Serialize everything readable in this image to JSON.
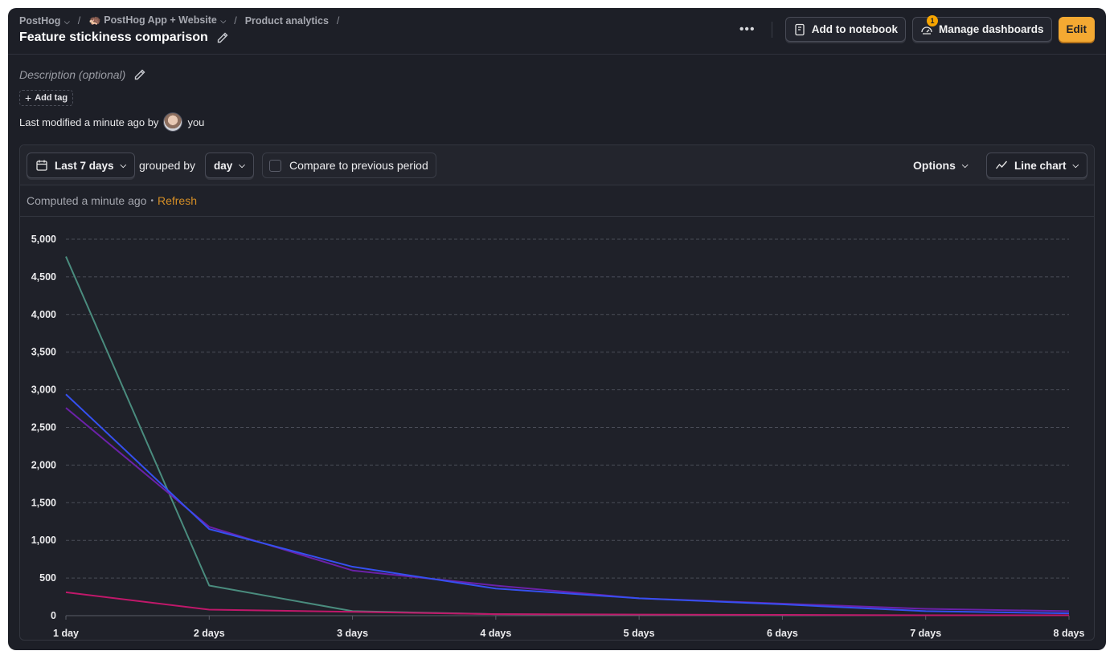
{
  "breadcrumbs": {
    "org": "PostHog",
    "project": "🦔 PostHog App + Website",
    "section": "Product analytics",
    "separator": "/"
  },
  "page": {
    "title": "Feature stickiness comparison",
    "description_placeholder": "Description (optional)",
    "add_tag_label": "Add tag",
    "modified_text": "Last modified a minute ago by",
    "modified_user": "you"
  },
  "toolbar": {
    "more_label": "•••",
    "add_to_notebook": "Add to notebook",
    "manage_dashboards": "Manage dashboards",
    "manage_dashboards_badge": "1",
    "edit": "Edit"
  },
  "controls": {
    "date_range": "Last 7 days",
    "grouped_by_label": "grouped by",
    "interval": "day",
    "compare_label": "Compare to previous period",
    "options_label": "Options",
    "chart_type_label": "Line chart"
  },
  "computed": {
    "text": "Computed a minute ago",
    "dot": "•",
    "refresh_label": "Refresh"
  },
  "chart_data": {
    "type": "line",
    "x": [
      "1 day",
      "2 days",
      "3 days",
      "4 days",
      "5 days",
      "6 days",
      "7 days",
      "8 days"
    ],
    "ylim": [
      0,
      5000
    ],
    "yticks": [
      0,
      500,
      1000,
      1500,
      2000,
      2500,
      3000,
      3500,
      4000,
      4500,
      5000
    ],
    "ytick_labels": [
      "0",
      "500",
      "1,000",
      "1,500",
      "2,000",
      "2,500",
      "3,000",
      "3,500",
      "4,000",
      "4,500",
      "5,000"
    ],
    "grid": true,
    "legend": "none",
    "series": [
      {
        "color": "#4a8c7e",
        "values": [
          4770,
          400,
          60,
          20,
          10,
          5,
          5,
          5
        ]
      },
      {
        "color": "#6b21a8",
        "values": [
          2760,
          1180,
          600,
          400,
          230,
          160,
          90,
          60
        ]
      },
      {
        "color": "#3550f0",
        "values": [
          2940,
          1150,
          650,
          360,
          230,
          150,
          60,
          30
        ]
      },
      {
        "color": "#c0186a",
        "values": [
          310,
          80,
          50,
          20,
          15,
          10,
          5,
          5
        ]
      }
    ]
  }
}
